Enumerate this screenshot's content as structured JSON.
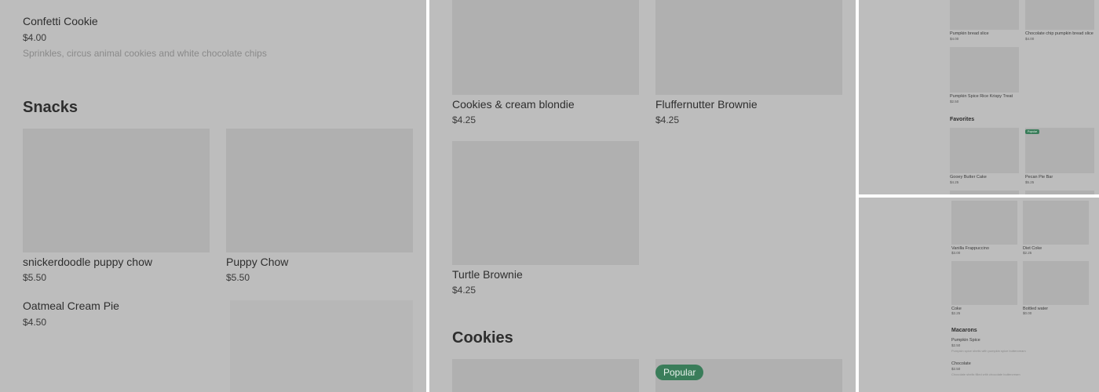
{
  "panel1": {
    "confetti": {
      "name": "Confetti Cookie",
      "price": "$4.00",
      "desc": "Sprinkles, circus animal cookies and white chocolate chips"
    },
    "section": "Snacks",
    "items": [
      {
        "name": "snickerdoodle puppy chow",
        "price": "$5.50"
      },
      {
        "name": "Puppy Chow",
        "price": "$5.50"
      },
      {
        "name": "Oatmeal Cream Pie",
        "price": "$4.50"
      }
    ]
  },
  "panel2": {
    "items": [
      {
        "name": "Cookies & cream blondie",
        "price": "$4.25"
      },
      {
        "name": "Fluffernutter Brownie",
        "price": "$4.25"
      },
      {
        "name": "Turtle Brownie",
        "price": "$4.25"
      }
    ],
    "section": "Cookies",
    "badge": "Popular"
  },
  "panel3": {
    "items": [
      {
        "name": "Pumpkin bread slice",
        "price": "$4.00"
      },
      {
        "name": "Chocolate chip pumpkin bread slice",
        "price": "$4.00"
      },
      {
        "name": "Pumpkin Spice Rice Krispy Treat",
        "price": "$2.50"
      }
    ],
    "section": "Favorites",
    "fav_items": [
      {
        "name": "Gooey Butter Cake",
        "price": "$4.25"
      },
      {
        "name": "Pecan Pie Bar",
        "price": "$5.25"
      }
    ],
    "badge": "Popular"
  },
  "panel4": {
    "items": [
      {
        "name": "Vanilla Frappuccino",
        "price": "$3.00"
      },
      {
        "name": "Diet Coke",
        "price": "$2.25"
      },
      {
        "name": "Coke",
        "price": "$2.25"
      },
      {
        "name": "Bottled water",
        "price": "$0.00"
      }
    ],
    "section": "Macarons",
    "macarons": [
      {
        "name": "Pumpkin Spice",
        "price": "$2.50",
        "desc": "Pumpkin spice shells with pumpkin spice buttercream"
      },
      {
        "name": "Chocolate",
        "price": "$2.50",
        "desc": "Chocolate shells filled with chocolate buttercream"
      }
    ]
  }
}
